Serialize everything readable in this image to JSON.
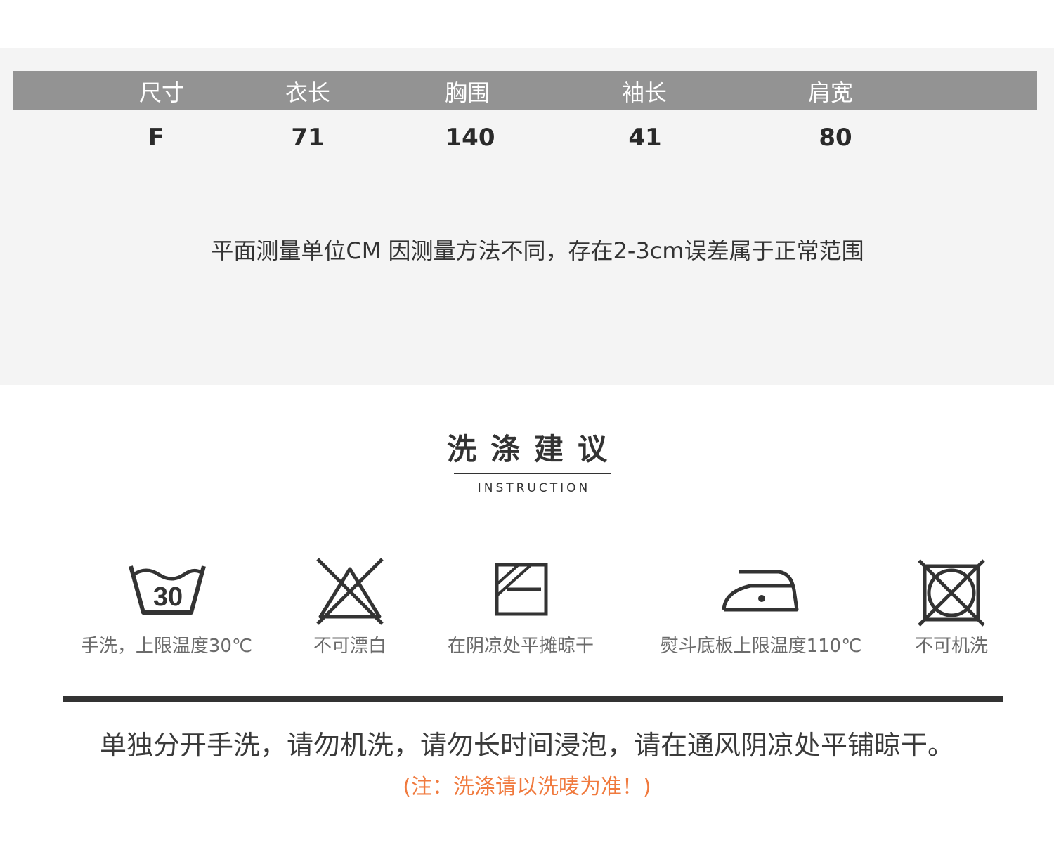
{
  "size_table": {
    "headers": [
      "尺寸",
      "衣长",
      "胸围",
      "袖长",
      "肩宽"
    ],
    "rows": [
      [
        "F",
        "71",
        "140",
        "41",
        "80"
      ]
    ],
    "note": "平面测量单位CM 因测量方法不同，存在2-3cm误差属于正常范围",
    "header_bg_color": "#939393",
    "panel_bg_color": "#f4f4f4"
  },
  "instruction": {
    "title": "洗涤建议",
    "subtitle": "INSTRUCTION"
  },
  "care_items": [
    {
      "icon": "wash-tub-30-icon",
      "temperature": "30",
      "label": "手洗，上限温度30℃"
    },
    {
      "icon": "no-bleach-icon",
      "label": "不可漂白"
    },
    {
      "icon": "dry-flat-in-shade-icon",
      "label": "在阴凉处平摊晾干"
    },
    {
      "icon": "iron-icon",
      "label": "熨斗底板上限温度110℃"
    },
    {
      "icon": "no-tumble-dry-icon",
      "label": "不可机洗"
    }
  ],
  "wash_note": "单独分开手洗，请勿机洗，请勿长时间浸泡，请在通风阴凉处平铺晾干。",
  "label_note": "(注：洗涤请以洗唛为准！)",
  "label_note_color": "#f07a3e",
  "icon_color": "#333333"
}
